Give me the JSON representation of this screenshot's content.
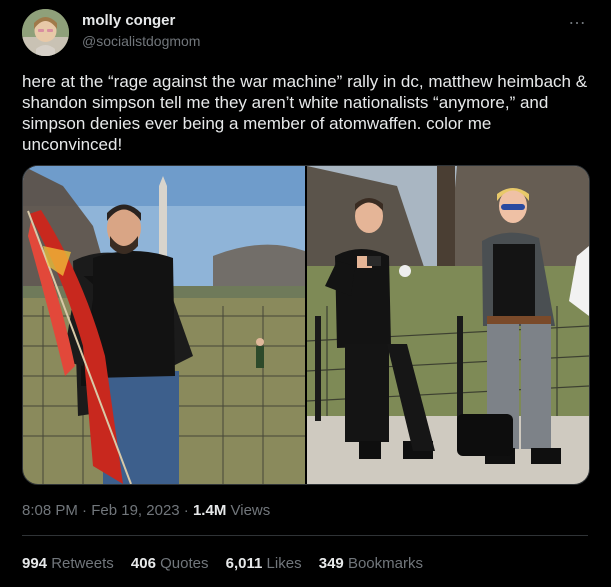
{
  "author": {
    "name": "molly conger",
    "handle": "@socialistdogmom",
    "avatar_icon": "profile-photo"
  },
  "more_icon": "…",
  "tweet_text": "here at the “rage against the war machine” rally in dc, matthew heimbach & shandon simpson tell me they aren’t white nationalists “anymore,” and simpson denies ever being a member of atomwaffen. color me unconvinced!",
  "meta": {
    "time": "8:08 PM",
    "date": "Feb 19, 2023",
    "views_count": "1.4M",
    "views_label": "Views"
  },
  "stats": {
    "retweets": {
      "count": "994",
      "label": "Retweets"
    },
    "quotes": {
      "count": "406",
      "label": "Quotes"
    },
    "likes": {
      "count": "6,011",
      "label": "Likes"
    },
    "bookmarks": {
      "count": "349",
      "label": "Bookmarks"
    }
  },
  "colors": {
    "background": "#000000",
    "text_primary": "#e7e9ea",
    "text_secondary": "#71767b",
    "border": "#2f3336"
  }
}
